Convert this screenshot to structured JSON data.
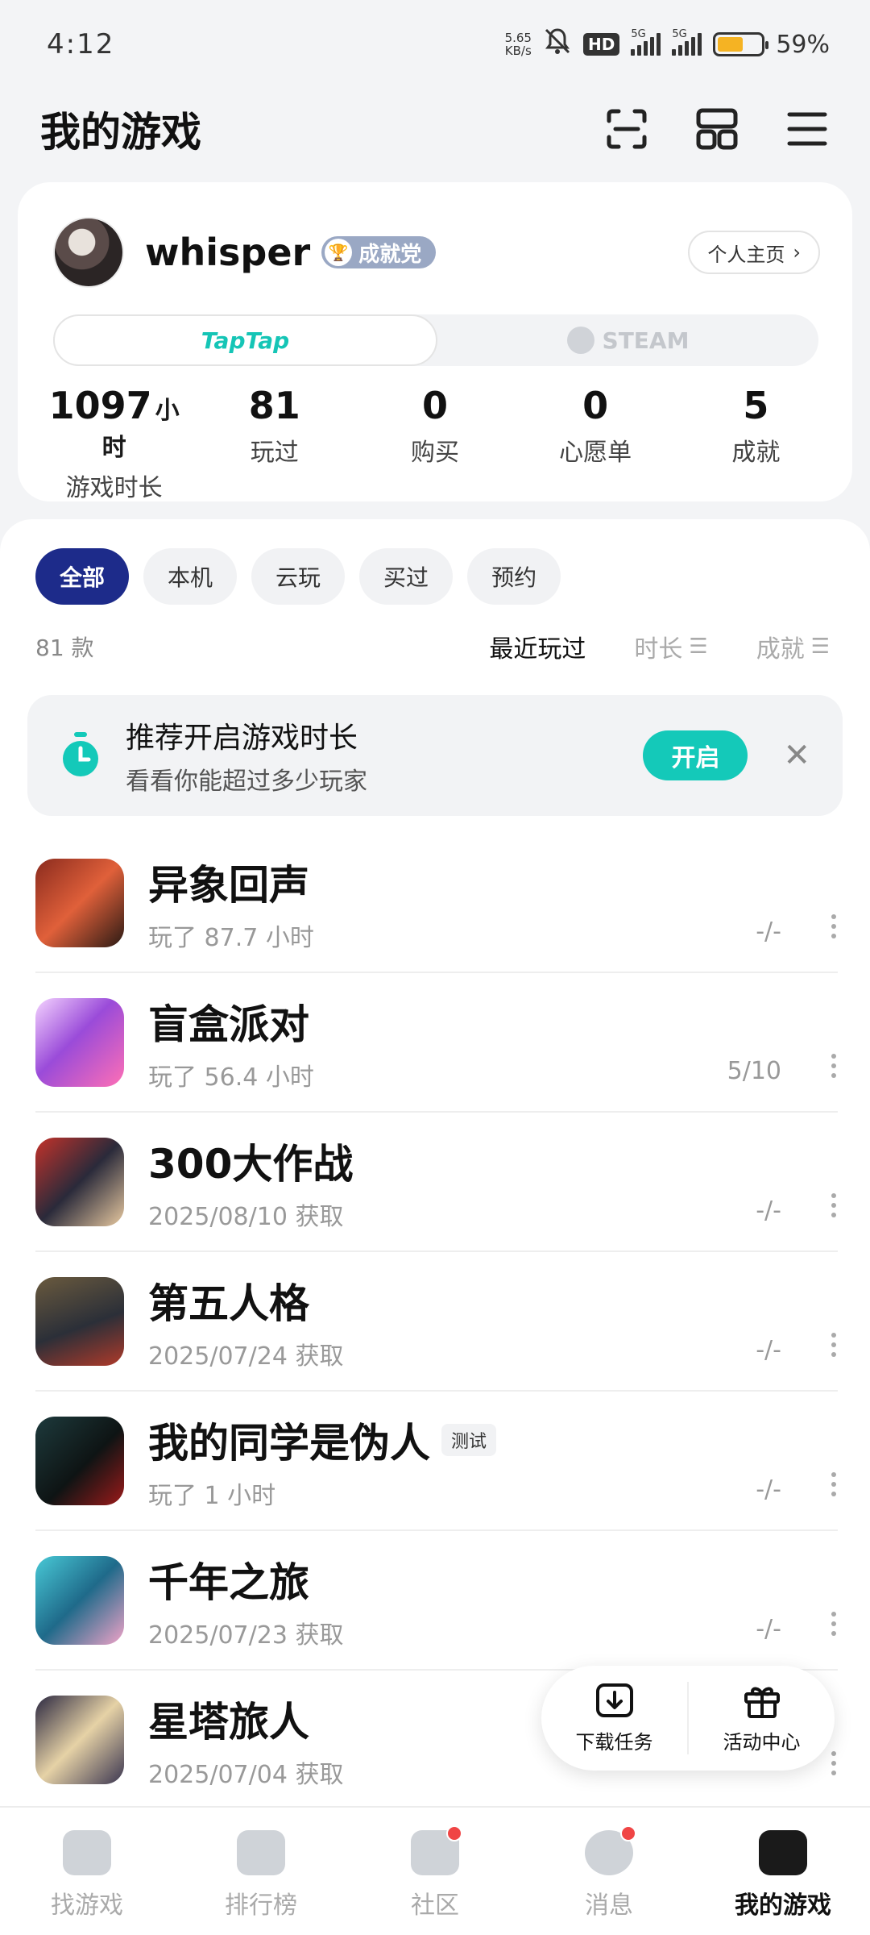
{
  "status_bar": {
    "time": "4:12",
    "net_speed_value": "5.65",
    "net_speed_unit": "KB/s",
    "hd_label": "HD",
    "signal_label_1": "5G",
    "signal_label_2": "5G",
    "battery_percent": "59%",
    "battery_level": 0.59
  },
  "header": {
    "title": "我的游戏",
    "icons": [
      "scan-icon",
      "grid-layout-icon",
      "menu-icon"
    ]
  },
  "profile": {
    "username": "whisper",
    "badge": "成就党",
    "homepage_button": "个人主页",
    "platforms": [
      "TapTap",
      "STEAM"
    ],
    "stats": [
      {
        "value": "1097",
        "unit": "小时",
        "label": "游戏时长"
      },
      {
        "value": "81",
        "unit": "",
        "label": "玩过"
      },
      {
        "value": "0",
        "unit": "",
        "label": "购买"
      },
      {
        "value": "0",
        "unit": "",
        "label": "心愿单"
      },
      {
        "value": "5",
        "unit": "",
        "label": "成就"
      }
    ]
  },
  "filters": [
    "全部",
    "本机",
    "云玩",
    "买过",
    "预约"
  ],
  "list": {
    "count": "81 款",
    "sorts": [
      "最近玩过",
      "时长",
      "成就"
    ]
  },
  "banner": {
    "title": "推荐开启游戏时长",
    "subtitle": "看看你能超过多少玩家",
    "button": "开启"
  },
  "games": [
    {
      "title": "异象回声",
      "sub": "玩了 87.7 小时",
      "achievement": "-/-",
      "tag": ""
    },
    {
      "title": "盲盒派对",
      "sub": "玩了 56.4 小时",
      "achievement": "5/10",
      "tag": ""
    },
    {
      "title": "300大作战",
      "sub": "2025/08/10 获取",
      "achievement": "-/-",
      "tag": ""
    },
    {
      "title": "第五人格",
      "sub": "2025/07/24 获取",
      "achievement": "-/-",
      "tag": ""
    },
    {
      "title": "我的同学是伪人",
      "sub": "玩了 1 小时",
      "achievement": "-/-",
      "tag": "测试"
    },
    {
      "title": "千年之旅",
      "sub": "2025/07/23 获取",
      "achievement": "-/-",
      "tag": ""
    },
    {
      "title": "星塔旅人",
      "sub": "2025/07/04 获取",
      "achievement": "",
      "tag": ""
    }
  ],
  "floating": {
    "download": "下载任务",
    "events": "活动中心"
  },
  "nav": [
    "找游戏",
    "排行榜",
    "社区",
    "消息",
    "我的游戏"
  ],
  "colors": {
    "accent": "#14c9b9",
    "filter_active": "#1d2b8a",
    "badge": "#9aa8c4",
    "notification": "#f04545"
  }
}
